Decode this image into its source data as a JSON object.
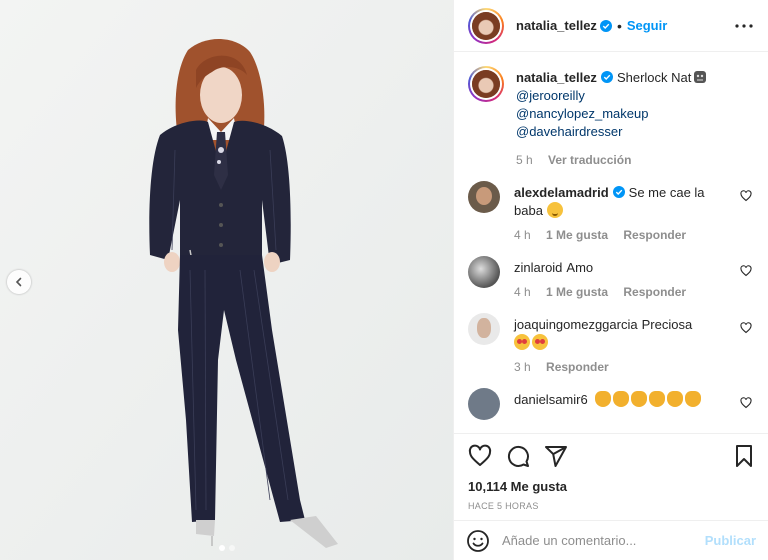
{
  "post": {
    "username": "natalia_tellez",
    "follow_label": "Seguir",
    "separator": "•"
  },
  "caption": {
    "username": "natalia_tellez",
    "text": "Sherlock Nat",
    "mentions": [
      "@jerooreilly",
      "@nancylopez_makeup",
      "@davehairdresser"
    ],
    "time": "5 h",
    "translate_label": "Ver traducción"
  },
  "comments": [
    {
      "username": "alexdelamadrid",
      "verified": true,
      "text": "Se me cae la baba",
      "emoji": "drooling-face",
      "time": "4 h",
      "likes": "1 Me gusta",
      "reply": "Responder"
    },
    {
      "username": "zinlaroid",
      "verified": false,
      "text": "Amo",
      "time": "4 h",
      "likes": "1 Me gusta",
      "reply": "Responder"
    },
    {
      "username": "joaquingomezggarcia",
      "verified": false,
      "text": "Preciosa",
      "emoji": "star-struck",
      "time": "3 h",
      "reply": "Responder"
    },
    {
      "username": "danielsamir6",
      "verified": false,
      "text": "",
      "emoji": "clapping-hands"
    }
  ],
  "stats": {
    "likes": "10,114 Me gusta",
    "ago": "HACE 5 HORAS"
  },
  "composer": {
    "placeholder": "Añade un comentario...",
    "publish_label": "Publicar"
  },
  "colors": {
    "link_blue": "#0095f6",
    "mention": "#00376b",
    "publish_disabled": "#b2dffc",
    "suit": "#23253a"
  },
  "icons": [
    "verified-badge-icon",
    "more-options-icon",
    "heart-icon",
    "comment-icon",
    "share-icon",
    "bookmark-icon",
    "emoji-smile-icon",
    "chevron-left-icon"
  ],
  "carousel": {
    "count": 2,
    "active": 1
  }
}
